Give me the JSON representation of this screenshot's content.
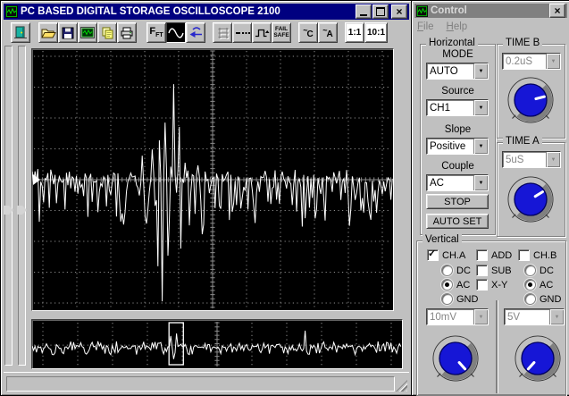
{
  "main_window": {
    "title": "PC BASED DIGITAL STORAGE OSCILLOSCOPE 2100",
    "toolbar": {
      "icons": [
        "exit-door",
        "open-folder",
        "floppy-save",
        "scope-screen",
        "copy-notes",
        "printer",
        "fft",
        "sine-wave",
        "undo-arrow",
        "grid",
        "dotted-line",
        "pulse-wave",
        "fail-safe",
        "trigger-couple-c",
        "trigger-couple-a",
        "probe-1to1",
        "probe-10to1"
      ],
      "fft": {
        "main": "F",
        "sub": "FT"
      },
      "fail_safe": {
        "line1": "FAIL",
        "line2": "SAFE"
      },
      "trigger_c": {
        "tilde": "~",
        "letter": "C"
      },
      "trigger_a": {
        "tilde": "~",
        "letter": "A"
      },
      "ratio_1to1": "1:1",
      "ratio_10to1": "10:1"
    }
  },
  "control_window": {
    "title": "Control",
    "menu": {
      "file": {
        "first": "F",
        "rest": "ile"
      },
      "help": {
        "first": "H",
        "rest": "elp"
      }
    },
    "horizontal": {
      "label": "Horizontal",
      "mode_label": "MODE",
      "mode_value": "AUTO",
      "source_label": "Source",
      "source_value": "CH1",
      "slope_label": "Slope",
      "slope_value": "Positive",
      "couple_label": "Couple",
      "couple_value": "AC",
      "stop_label": "STOP",
      "auto_set_label": "AUTO SET"
    },
    "time_b": {
      "label": "TIME B",
      "value": "0.2uS",
      "knob_angle": -14
    },
    "time_a": {
      "label": "TIME A",
      "value": "5uS",
      "knob_angle": -32
    },
    "vertical": {
      "label": "Vertical",
      "ch_a": {
        "label": "CH.A",
        "checked": true
      },
      "add": {
        "label": "ADD",
        "checked": false
      },
      "ch_b": {
        "label": "CH.B",
        "checked": false
      },
      "sub": {
        "label": "SUB",
        "checked": false
      },
      "xy": {
        "label": "X-Y",
        "checked": false
      },
      "ch_a_coupling": {
        "options": [
          "DC",
          "AC",
          "GND"
        ],
        "selected": "AC"
      },
      "ch_b_coupling": {
        "options": [
          "DC",
          "AC",
          "GND"
        ],
        "selected": "AC"
      },
      "ch_a_scale": "10mV",
      "ch_b_scale": "5V",
      "ch_a_knob_angle": 48,
      "ch_b_knob_angle": 132
    }
  },
  "scope": {
    "trigger_fy": 0.5,
    "trace": {
      "seed": 7,
      "base_fy": 0.493,
      "noise_down": 0.19,
      "noise_up": 0.035,
      "spikes": [
        [
          0.304,
          0.408
        ],
        [
          0.317,
          0.668
        ],
        [
          0.332,
          0.384
        ],
        [
          0.342,
          0.6
        ],
        [
          0.349,
          0.832
        ],
        [
          0.354,
          0.349
        ],
        [
          0.361,
          0.966
        ],
        [
          0.369,
          0.281
        ],
        [
          0.376,
          0.791
        ],
        [
          0.385,
          0.45
        ],
        [
          0.394,
          0.134
        ],
        [
          0.4,
          0.55
        ],
        [
          0.406,
          0.298
        ],
        [
          0.413,
          0.764
        ],
        [
          0.423,
          0.435
        ],
        [
          0.436,
          0.675
        ],
        [
          0.446,
          0.486
        ],
        [
          0.46,
          0.445
        ],
        [
          0.47,
          0.709
        ],
        [
          0.48,
          0.469
        ],
        [
          0.525,
          0.479
        ]
      ]
    }
  },
  "overview": {
    "trace": {
      "seed": 13,
      "base_fy": 0.556,
      "noise_down": 0.17,
      "noise_up": 0.13,
      "spikes": [
        [
          0.375,
          0.33
        ],
        [
          0.382,
          0.81
        ],
        [
          0.39,
          0.28
        ],
        [
          0.739,
          0.22
        ]
      ]
    },
    "selection_box": {
      "fx": 0.37,
      "fw": 0.039
    }
  },
  "colors": {
    "titlebar_active": "#000080",
    "titlebar_inactive": "#808080",
    "chrome": "#c0c0c0",
    "screen_bg": "#000000",
    "trace": "#ffffff",
    "grid": "#8c8c8c",
    "knob_blue": "#1616d6",
    "toolbar_arrow_blue": "#2828cc"
  }
}
